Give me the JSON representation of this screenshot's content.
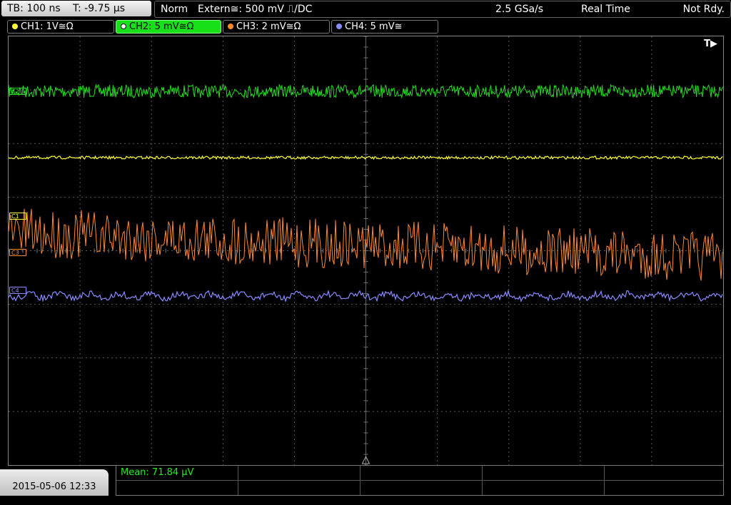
{
  "header": {
    "timebase": "TB: 100 ns",
    "trigger_time": "T: -9.75 µs",
    "mode": "Norm",
    "trigger": "Extern≅: 500 mV ⎍/DC",
    "sample_rate": "2.5 GSa/s",
    "acquisition": "Real Time",
    "status": "Not Rdy."
  },
  "channels": [
    {
      "label": "CH1: 1V≅Ω",
      "color": "#ffff33"
    },
    {
      "label": "CH2: 5 mV≅Ω",
      "color": "#22dd22"
    },
    {
      "label": "CH3: 2 mV≅Ω",
      "color": "#ff8a2a"
    },
    {
      "label": "CH4: 5 mV≅",
      "color": "#8a8aff"
    }
  ],
  "markers": {
    "c2": "C2",
    "c1": "C1",
    "c3": "C3",
    "c4": "C4"
  },
  "trigger_indicator": "T▶",
  "footer": {
    "datetime": "2015-05-06 12:33",
    "measurement": "Mean: 71.84 µV"
  },
  "colors": {
    "ch1": "#ffff33",
    "ch2": "#22dd22",
    "ch3": "#ff8a2a",
    "ch4": "#8a8aff",
    "grid": "#5a5a5a"
  }
}
